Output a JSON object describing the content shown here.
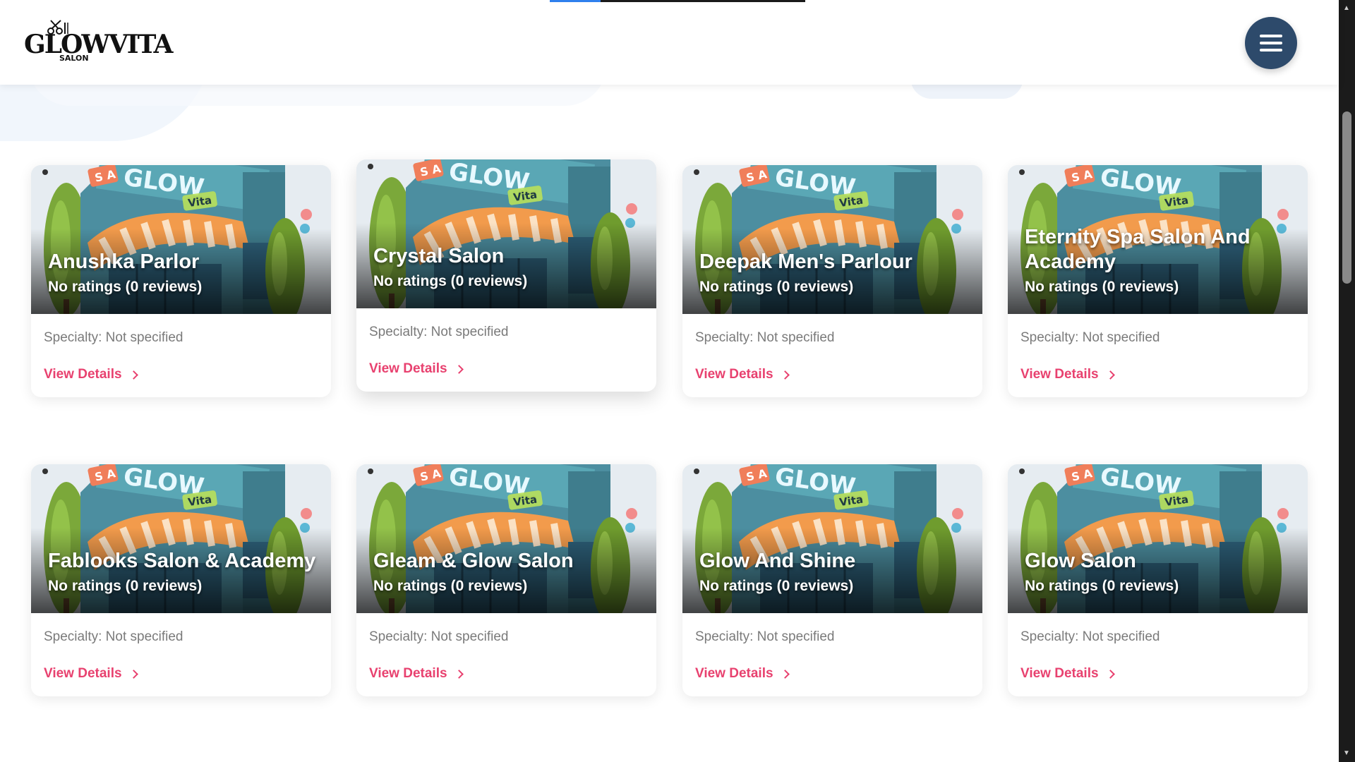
{
  "header": {
    "logo_text": "GLOWVITA",
    "logo_subtext": "SALON",
    "progress_fraction": 0.2,
    "menu_icon": "hamburger-menu-icon"
  },
  "salons": [
    {
      "name": "Anushka Parlor",
      "rating": "No ratings (0 reviews)",
      "specialty": "Specialty: Not specified",
      "link": "View Details"
    },
    {
      "name": "Crystal Salon",
      "rating": "No ratings (0 reviews)",
      "specialty": "Specialty: Not specified",
      "link": "View Details"
    },
    {
      "name": "Deepak Men's Parlour",
      "rating": "No ratings (0 reviews)",
      "specialty": "Specialty: Not specified",
      "link": "View Details"
    },
    {
      "name": "Eternity Spa Salon And Academy",
      "rating": "No ratings (0 reviews)",
      "specialty": "Specialty: Not specified",
      "link": "View Details"
    },
    {
      "name": "Fablooks Salon & Academy",
      "rating": "No ratings (0 reviews)",
      "specialty": "Specialty: Not specified",
      "link": "View Details"
    },
    {
      "name": "Gleam & Glow Salon",
      "rating": "No ratings (0 reviews)",
      "specialty": "Specialty: Not specified",
      "link": "View Details"
    },
    {
      "name": "Glow And Shine",
      "rating": "No ratings (0 reviews)",
      "specialty": "Specialty: Not specified",
      "link": "View Details"
    },
    {
      "name": "Glow Salon",
      "rating": "No ratings (0 reviews)",
      "specialty": "Specialty: Not specified",
      "link": "View Details"
    }
  ],
  "salon_image_sign": "GLOW",
  "salon_image_sign_sub": "Vita",
  "colors": {
    "accent_link": "#e8416f",
    "menu_button": "#2d4a6b",
    "progress": "#2f80ed"
  }
}
